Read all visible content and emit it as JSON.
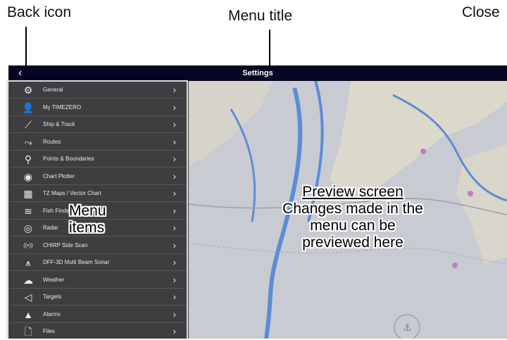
{
  "callouts": {
    "back_icon": "Back icon",
    "menu_title": "Menu title",
    "close": "Close",
    "menu_items": [
      "Menu",
      "items"
    ],
    "preview": {
      "heading": "Preview screen",
      "lines": [
        "Changes made in the",
        "menu can be",
        "previewed here"
      ]
    }
  },
  "header": {
    "back": "‹",
    "title": "Settings"
  },
  "menu": {
    "items": [
      {
        "label": "General",
        "icon": "gears-icon",
        "glyph": "⚙"
      },
      {
        "label": "My TIMEZERO",
        "icon": "user-tz-icon",
        "glyph": "👤"
      },
      {
        "label": "Ship & Track",
        "icon": "ship-track-icon",
        "glyph": "⟋"
      },
      {
        "label": "Routes",
        "icon": "route-icon",
        "glyph": "⤳"
      },
      {
        "label": "Points & Boundaries",
        "icon": "points-icon",
        "glyph": "⚲"
      },
      {
        "label": "Chart Plotter",
        "icon": "chart-plotter-icon",
        "glyph": "◉"
      },
      {
        "label": "TZ Maps / Vector Chart",
        "icon": "tz-maps-icon",
        "glyph": "▦"
      },
      {
        "label": "Fish Finder",
        "icon": "fish-finder-icon",
        "glyph": "≋"
      },
      {
        "label": "Radar",
        "icon": "radar-icon",
        "glyph": "◎"
      },
      {
        "label": "CHIRP Side Scan",
        "icon": "side-scan-icon",
        "glyph": "((•))"
      },
      {
        "label": "DFF-3D Multi Beam Sonar",
        "icon": "sonar-icon",
        "glyph": "⩚"
      },
      {
        "label": "Weather",
        "icon": "weather-icon",
        "glyph": "☁"
      },
      {
        "label": "Targets",
        "icon": "targets-icon",
        "glyph": "◁"
      },
      {
        "label": "Alarms",
        "icon": "alarm-icon",
        "glyph": "▲"
      },
      {
        "label": "Files",
        "icon": "files-icon",
        "glyph": "🗋"
      }
    ],
    "chevron": "›"
  }
}
